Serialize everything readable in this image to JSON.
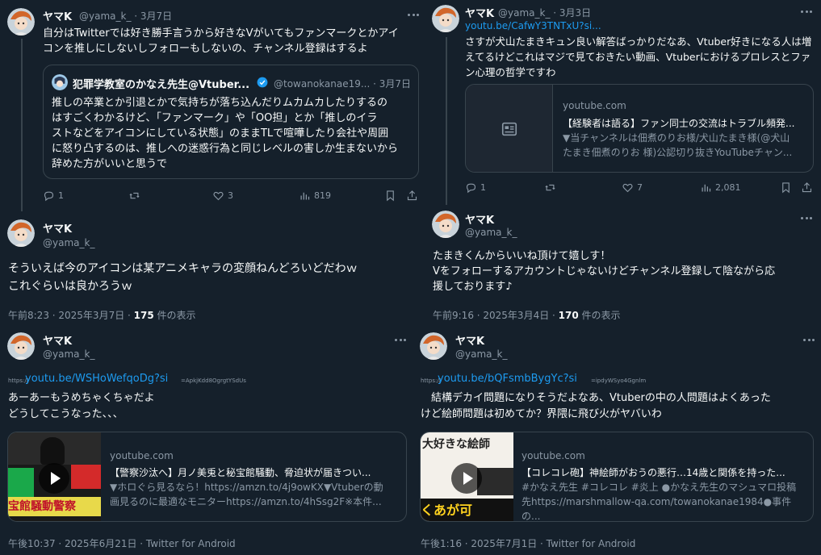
{
  "tweet_tl": {
    "name": "ヤマK",
    "handle": "@yama_k_ · 3月7日",
    "text_lines": [
      "自分はTwitterでは好き勝手言うから好きなVがいてもファンマークとかアイ",
      "コンを推しにしないしフォローもしないの、チャンネル登録はするよ"
    ],
    "quote": {
      "name": "犯罪学教室のかなえ先生@Vtuber...",
      "handle": "@towanokanae19... · 3月7日",
      "text_lines": [
        "推しの卒業とか引退とかで気持ちが落ち込んだりムカムカしたりするの",
        "はすごくわかるけど、「ファンマーク」や「OO担」とか「推しのイラ",
        "ストなどをアイコンにしている状態」のままTLで喧嘩したり会社や周囲",
        "に怒り凸するのは、推しへの迷惑行為と同じレベルの害しか生まないから",
        "辞めた方がいいと思うで"
      ]
    },
    "actions": {
      "reply": "1",
      "retweet": "",
      "like": "3",
      "views": "819"
    }
  },
  "tweet_tl_reply": {
    "name": "ヤマK",
    "handle": "@yama_k_",
    "text_lines": [
      "そういえば今のアイコンは某アニメキャラの変顔ねんどろいどだわｗ",
      "これぐらいは良かろうｗ"
    ],
    "time": "午前8:23 · 2025年3月7日 · ",
    "views_count": "175",
    "views_label": " 件の表示"
  },
  "tweet_tr": {
    "name": "ヤマK",
    "handle": "@yama_k_ · 3月3日",
    "link": "youtu.be/CafwY3TNTxU?si...",
    "text_lines": [
      "さすが犬山たまきキュン良い解答ばっかりだなあ、Vtuber好きになる人は増",
      "えてるけどこれはマジで見ておきたい動画、Vtuberにおけるプロレスとファ",
      "ン心理の哲学ですわ"
    ],
    "card": {
      "domain": "youtube.com",
      "title": "【経験者は語る】ファン同士の交流はトラブル頻発...",
      "desc_lines": [
        "▼当チャンネルは佃煮のりお様/犬山たまき様(@犬山",
        "たまき佃煮のりお 様)公認切り抜きYouTubeチャン..."
      ]
    },
    "actions": {
      "reply": "1",
      "retweet": "",
      "like": "7",
      "views": "2,081"
    }
  },
  "tweet_tr_reply": {
    "name": "ヤマK",
    "handle": "@yama_k_",
    "text_lines": [
      "たまきくんからいいね頂けて嬉しす！",
      "Vをフォローするアカウントじゃないけどチャンネル登録して陰ながら応",
      "援しております♪"
    ],
    "time": "午前9:16 · 2025年3月4日 · ",
    "views_count": "170",
    "views_label": " 件の表示"
  },
  "tweet_bl": {
    "name": "ヤマK",
    "handle": "@yama_k_",
    "link_prefix": "https://",
    "link": "youtu.be/WSHoWefqoDg?si",
    "link_tail": "=ApkjKdd8OgrgtYSdUs",
    "text_lines": [
      "あーあーもうめちゃくちゃだよ",
      "どうしてこうなった、、、"
    ],
    "card": {
      "domain": "youtube.com",
      "title": "【警察沙汰へ】月ノ美兎と秘宝館騒動、脅迫状が届きつい...",
      "desc_lines": [
        "▼ホロぐら見るなら！https://amzn.to/4j9owKX▼Vtuberの動",
        "画見るのに最適なモニターhttps://amzn.to/4hSsg2F※本件..."
      ],
      "thumb_text": "宝館騒動警察"
    },
    "time": "午後10:37 · 2025年6月21日 · Twitter for Android"
  },
  "tweet_br": {
    "name": "ヤマK",
    "handle": "@yama_k_",
    "link_prefix": "https://",
    "link": "youtu.be/bQFsmbBygYc?si",
    "link_tail": "=ipdyWSyo4Ggnlm",
    "text_lines": [
      "　結構デカイ問題になりそうだよなあ、Vtuberの中の人問題はよくあった",
      "けど絵師問題は初めてか？界隈に飛び火がヤバいわ"
    ],
    "card": {
      "domain": "youtube.com",
      "title": "【コレコレ砲】神絵師がおうの悪行…14歳と関係を持った...",
      "desc_lines": [
        "#かなえ先生 #コレコレ #炎上 ●かなえ先生のマシュマロ投稿",
        "先https://marshmallow-qa.com/towanokanae1984●事件の..."
      ],
      "thumb_text_1": "大好きな絵師",
      "thumb_text_2": "くあが可"
    },
    "time": "午後1:16 · 2025年7月1日 · Twitter for Android"
  },
  "colors": {
    "background": "#15202b",
    "text": "#f7f9f9",
    "muted": "#8b98a5",
    "link": "#1d9bf0",
    "border": "#38444d",
    "verified": "#1d9bf0"
  }
}
